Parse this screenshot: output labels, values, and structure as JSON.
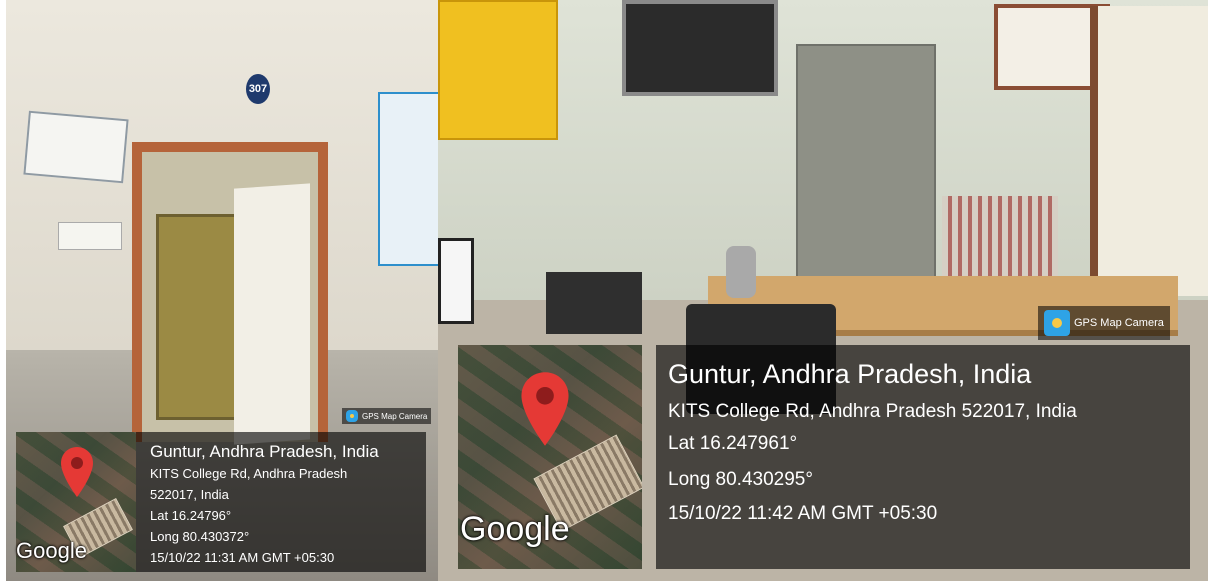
{
  "left_photo": {
    "room_number": "307",
    "map_attribution": "Google",
    "camera_badge": "GPS Map Camera",
    "location": {
      "city_line": "Guntur, Andhra Pradesh, India",
      "address_line_1": "KITS College Rd, Andhra Pradesh",
      "address_line_2": "522017, India",
      "lat": "Lat 16.24796°",
      "long": "Long 80.430372°",
      "timestamp": "15/10/22 11:31 AM GMT +05:30"
    }
  },
  "right_photo": {
    "map_attribution": "Google",
    "camera_badge": "GPS Map Camera",
    "location": {
      "city_line": "Guntur, Andhra Pradesh, India",
      "address_line": "KITS College Rd, Andhra Pradesh 522017, India",
      "lat": "Lat 16.247961°",
      "long": "Long 80.430295°",
      "timestamp": "15/10/22 11:42 AM GMT +05:30"
    }
  },
  "colors": {
    "pin": "#e53935",
    "overlay": "#000000",
    "door_frame": "#b5643a",
    "camera_icon": "#2ea3e6"
  },
  "icons": [
    "map-pin-icon",
    "gps-map-camera-icon"
  ]
}
